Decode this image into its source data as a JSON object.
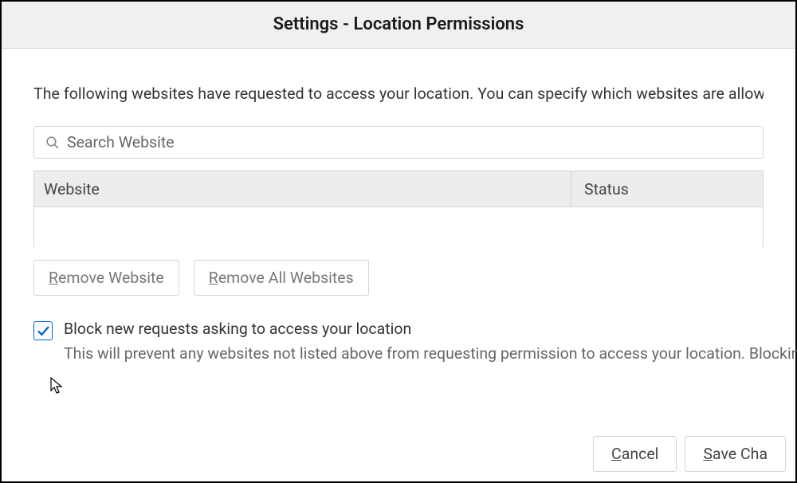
{
  "header": {
    "title": "Settings - Location Permissions"
  },
  "description": "The following websites have requested to access your location. You can specify which websites are allowed to access your location. You can also block new requests asking to access your location.",
  "search": {
    "placeholder": "Search Website"
  },
  "table": {
    "col_website": "Website",
    "col_status": "Status",
    "rows": []
  },
  "buttons": {
    "remove_website": "Remove Website",
    "remove_all": "Remove All Websites"
  },
  "block_option": {
    "checked": true,
    "label": "Block new requests asking to access your location",
    "desc": "This will prevent any websites not listed above from requesting permission to access your location. Blocking access to your location may break some website features."
  },
  "footer": {
    "cancel": "Cancel",
    "save": "Save Changes"
  }
}
